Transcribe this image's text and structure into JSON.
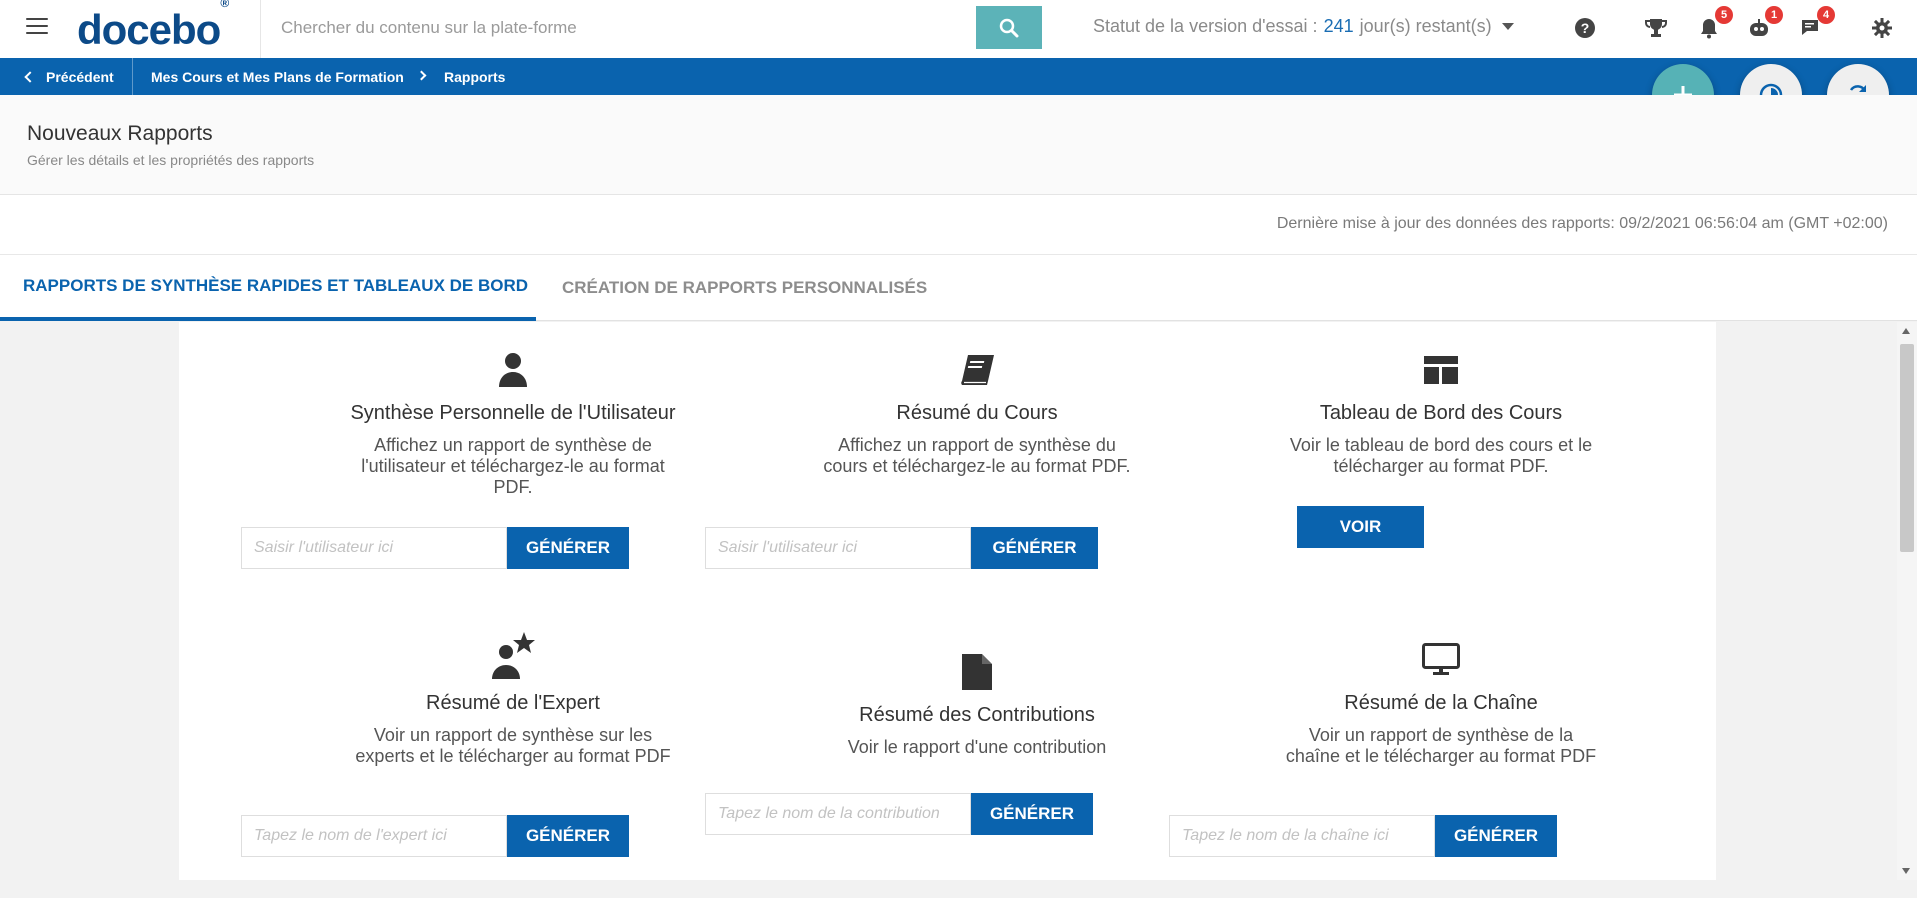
{
  "header": {
    "logo": "docebo",
    "logo_mark": "®",
    "search_placeholder": "Chercher du contenu sur la plate-forme",
    "trial_prefix": "Statut de la version d'essai :",
    "trial_days": "241",
    "trial_suffix": "jour(s) restant(s)",
    "badges": {
      "notifications": "5",
      "robot": "1",
      "messages": "4"
    }
  },
  "breadcrumb": {
    "back_label": "Précédent",
    "items": [
      "Mes Cours et Mes Plans de Formation",
      "Rapports"
    ]
  },
  "page": {
    "title": "Nouveaux Rapports",
    "subtitle": "Gérer les détails et les propriétés des rapports",
    "last_update": "Dernière mise à jour des données des rapports: 09/2/2021 06:56:04 am (GMT +02:00)"
  },
  "tabs": [
    {
      "label": "RAPPORTS DE SYNTHÈSE RAPIDES ET TABLEAUX DE BORD",
      "active": true
    },
    {
      "label": "CRÉATION DE RAPPORTS PERSONNALISÉS",
      "active": false
    }
  ],
  "cards": [
    {
      "icon": "user-icon",
      "title": "Synthèse Personnelle de l'Utilisateur",
      "desc": "Affichez un rapport de synthèse de l'utilisateur et téléchargez-le au format PDF.",
      "placeholder": "Saisir l'utilisateur ici",
      "button": "GÉNÉRER"
    },
    {
      "icon": "book-icon",
      "title": "Résumé du Cours",
      "desc": "Affichez un rapport de synthèse du cours et téléchargez-le au format PDF.",
      "placeholder": "Saisir l'utilisateur ici",
      "button": "GÉNÉRER"
    },
    {
      "icon": "dashboard-icon",
      "title": "Tableau de Bord des Cours",
      "desc": "Voir le tableau de bord des cours et le télécharger au format PDF.",
      "button": "VOIR"
    },
    {
      "icon": "expert-icon",
      "title": "Résumé de l'Expert",
      "desc": "Voir un rapport de synthèse sur les experts et le télécharger au format PDF",
      "placeholder": "Tapez le nom de l'expert ici",
      "button": "GÉNÉRER"
    },
    {
      "icon": "document-icon",
      "title": "Résumé des Contributions",
      "desc": "Voir le rapport d'une contribution",
      "placeholder": "Tapez le nom de la contribution",
      "button": "GÉNÉRER"
    },
    {
      "icon": "monitor-icon",
      "title": "Résumé de la Chaîne",
      "desc": "Voir un rapport de synthèse de la chaîne et le télécharger au format PDF",
      "placeholder": "Tapez le nom de la chaîne ici",
      "button": "GÉNÉRER"
    }
  ],
  "colors": {
    "brand_blue": "#0a63ae",
    "teal": "#56b2b6",
    "badge_red": "#e53935"
  }
}
